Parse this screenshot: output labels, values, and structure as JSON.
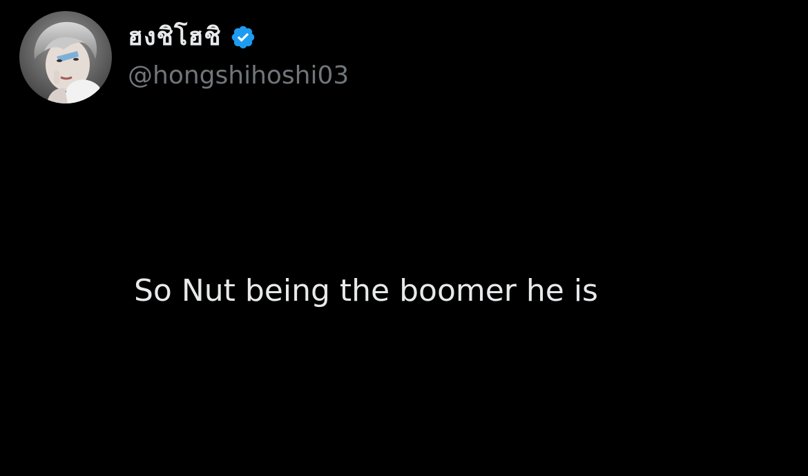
{
  "tweet": {
    "author": {
      "display_name": "ฮงชิโฮชิ",
      "handle": "@hongshihoshi03",
      "verified": true,
      "avatar_icon": "profile-photo",
      "verified_icon": "verified-badge-icon",
      "verified_color": "#1d9bf0"
    },
    "text": "So Nut being the boomer he is"
  },
  "colors": {
    "background": "#000000",
    "primary_text": "#e7e9ea",
    "secondary_text": "#71767b"
  }
}
